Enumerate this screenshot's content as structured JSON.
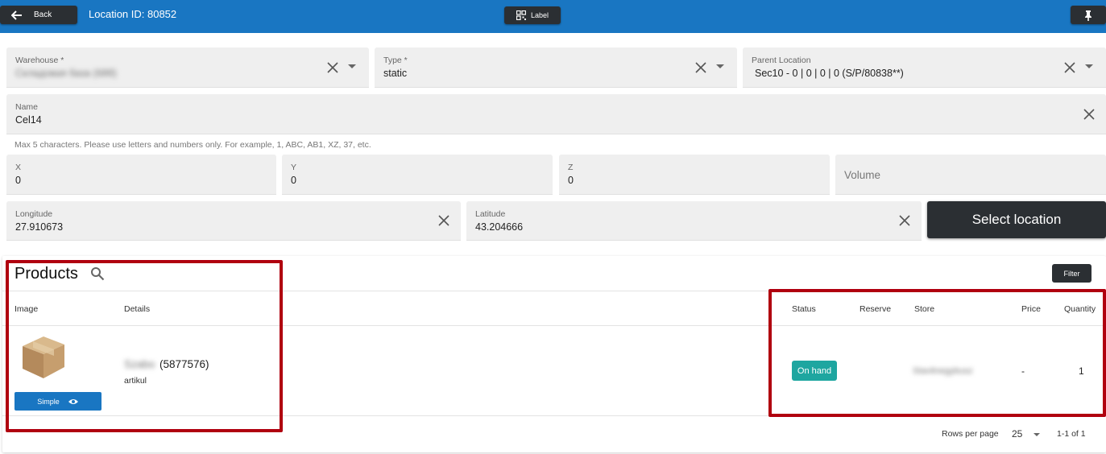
{
  "header": {
    "back_label": "Back",
    "title": "Location ID: 80852",
    "label_button": "Label",
    "pin_icon": "pin-icon"
  },
  "form": {
    "warehouse": {
      "label": "Warehouse *",
      "value": "Складовая база (688)"
    },
    "type": {
      "label": "Type *",
      "value": "static"
    },
    "parent": {
      "label": "Parent Location",
      "value": "Sec10 - 0 | 0 | 0 | 0 (S/P/80838**)"
    },
    "name": {
      "label": "Name",
      "value": "Cel14"
    },
    "name_hint": "Max 5 characters. Please use letters and numbers only. For example, 1, ABC, AB1, XZ, 37, etc.",
    "x": {
      "label": "X",
      "value": "0"
    },
    "y": {
      "label": "Y",
      "value": "0"
    },
    "z": {
      "label": "Z",
      "value": "0"
    },
    "volume": {
      "placeholder": "Volume"
    },
    "longitude": {
      "label": "Longitude",
      "value": "27.910673"
    },
    "latitude": {
      "label": "Latitude",
      "value": "43.204666"
    },
    "select_location_label": "Select location"
  },
  "products": {
    "title": "Products",
    "filter_label": "Filter",
    "columns": {
      "image": "Image",
      "details": "Details",
      "status": "Status",
      "reserve": "Reserve",
      "store": "Store",
      "price": "Price",
      "quantity": "Quantity"
    },
    "rows": [
      {
        "type_label": "Simple",
        "name_blurred": "Szabo",
        "name_id": "(5877576)",
        "sub": "artikul",
        "status": "On hand",
        "reserve": "",
        "store": "Stavitnegybusz",
        "price": "-",
        "quantity": "1"
      }
    ],
    "pagination": {
      "rows_per_page_label": "Rows per page",
      "rows_per_page": "25",
      "range": "1-1 of 1"
    }
  },
  "colors": {
    "primary": "#1976c2",
    "dark_button": "#2b2f33",
    "status_on_hand": "#1ea6a0",
    "annotation": "#b0000f"
  }
}
